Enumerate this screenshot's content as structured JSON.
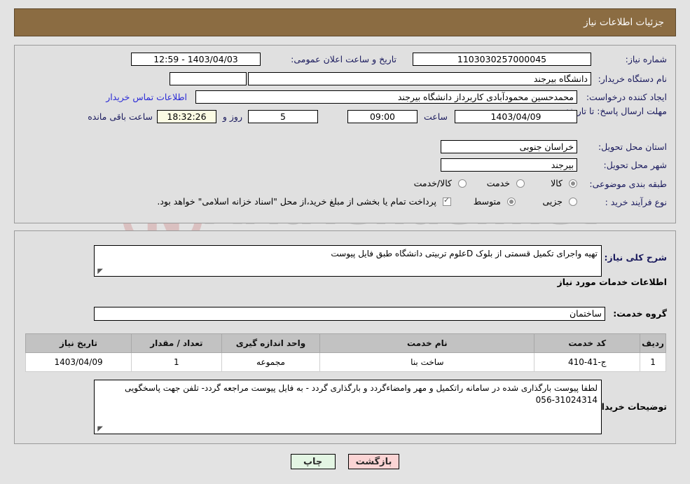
{
  "header": {
    "title": "جزئیات اطلاعات نیاز"
  },
  "top_panel": {
    "need_number_label": "شماره نیاز:",
    "need_number_value": "1103030257000045",
    "public_announce_label": "تاریخ و ساعت اعلان عمومی:",
    "public_announce_value": "1403/04/03 - 12:59",
    "buyer_org_label": "نام دستگاه خریدار:",
    "buyer_org_value": "دانشگاه بیرجند",
    "buyer_org_extra_value": "",
    "creator_label": "ایجاد کننده درخواست:",
    "creator_value": "محمدحسین محمودآبادی کاربرداز دانشگاه بیرجند",
    "contact_link": "اطلاعات تماس خریدار",
    "deadline_label": "مهلت ارسال پاسخ: تا تاریخ:",
    "deadline_date": "1403/04/09",
    "hour_label": "ساعت",
    "hour_value": "09:00",
    "days_value": "5",
    "days_unit": "روز و",
    "countdown_value": "18:32:26",
    "countdown_unit": "ساعت باقی مانده",
    "province_label": "استان محل تحویل:",
    "province_value": "خراسان جنوبی",
    "city_label": "شهر محل تحویل:",
    "city_value": "بیرجند",
    "category_label": "طبقه بندی موضوعی:",
    "category_options": [
      {
        "label": "کالا",
        "selected": true
      },
      {
        "label": "خدمت",
        "selected": false
      },
      {
        "label": "کالا/خدمت",
        "selected": false
      }
    ],
    "process_label": "نوع فرآیند خرید :",
    "process_options": [
      {
        "label": "جزیی",
        "selected": false
      },
      {
        "label": "متوسط",
        "selected": true
      }
    ],
    "payment_checkbox_label": "پرداخت تمام یا بخشی از مبلغ خرید،از محل \"اسناد خزانه اسلامی\" خواهد بود.",
    "payment_checked": true
  },
  "mid_panel": {
    "general_desc_label": "شرح کلی نیاز:",
    "general_desc_value": "تهیه واجرای تکمیل قسمتی از بلوک Dعلوم تربیتی دانشگاه طبق فایل پیوست",
    "services_heading": "اطلاعات خدمات مورد نیاز",
    "service_group_label": "گروه خدمت:",
    "service_group_value": "ساختمان",
    "buyer_notes_label": "توضیحات خریدار:",
    "buyer_notes_value": "لطفا پیوست بارگذاری شده در سامانه راتکمیل و مهر وامضاءگردد و بارگذاری گردد - به فایل پیوست مراجعه گردد- تلفن جهت پاسخگویی 31024314-056"
  },
  "table": {
    "columns": [
      "ردیف",
      "کد خدمت",
      "نام خدمت",
      "واحد اندازه گیری",
      "تعداد / مقدار",
      "تاریخ نیاز"
    ],
    "rows": [
      {
        "radif": "1",
        "code": "ج-41-410",
        "name": "ساخت بنا",
        "unit": "مجموعه",
        "qty": "1",
        "date": "1403/04/09"
      }
    ]
  },
  "buttons": {
    "print": "چاپ",
    "back": "بازگشت"
  },
  "watermark": {
    "text": "AriaTender.net"
  },
  "colors": {
    "title_bar": "#8b6c42",
    "page_bg": "#e3e3e3",
    "panel_bg": "#e0e0e0",
    "label_text": "#1b1b5e",
    "link": "#2a2ad6",
    "table_header": "#c2c2c2",
    "countdown_bg": "#fbfbe3",
    "print_btn": "#e3f5e3",
    "back_btn": "#fbd4d4"
  }
}
